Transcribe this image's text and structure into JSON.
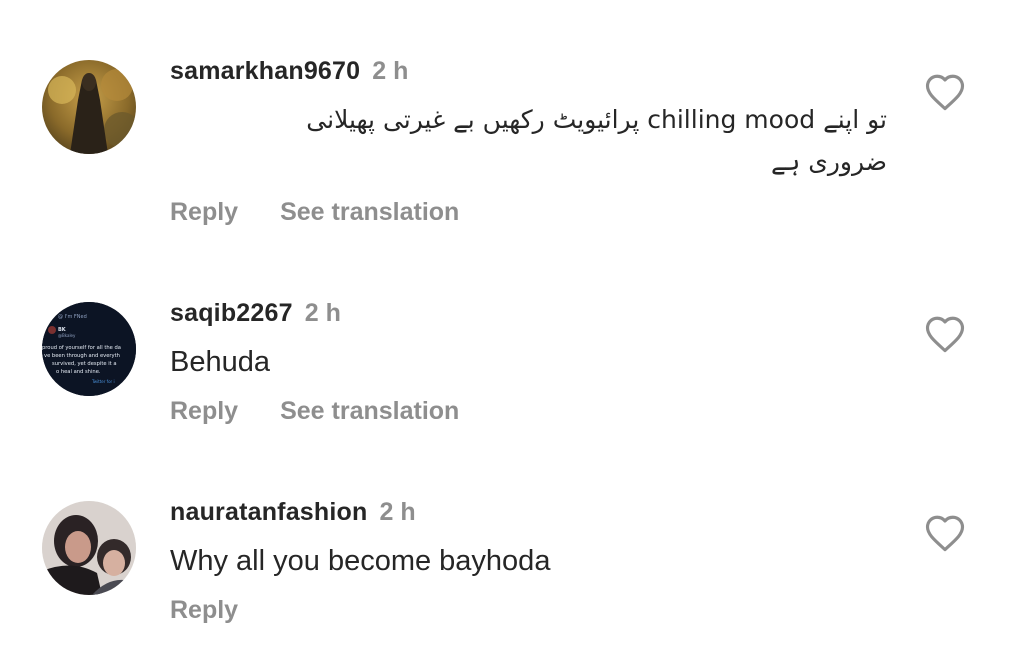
{
  "comments": [
    {
      "username": "samarkhan9670",
      "time": "2 h",
      "text_line1": "تو اپنے chilling mood پرائیویٹ رکھیں بے غیرتی پھیلانی",
      "text_line2": "ضروری ہے",
      "reply_label": "Reply",
      "translate_label": "See translation"
    },
    {
      "username": "saqib2267",
      "time": "2 h",
      "text": "Behuda",
      "reply_label": "Reply",
      "translate_label": "See translation",
      "avatar_text": {
        "handle_line": "@ I'm FNed",
        "name": "BK",
        "sub": "@Bkaley",
        "l1": "proud of yourself for all the da",
        "l2": "ve been through and everyth",
        "l3": "survived, yet despite it a",
        "l4": "o heal and shine.",
        "footer": "Twitter for i"
      }
    },
    {
      "username": "nauratanfashion",
      "time": "2 h",
      "text": "Why all you become bayhoda",
      "reply_label": "Reply"
    }
  ],
  "icons": {
    "like": "heart-outline-icon"
  },
  "colors": {
    "primary_text": "#262626",
    "secondary_text": "#8e8e8e"
  }
}
